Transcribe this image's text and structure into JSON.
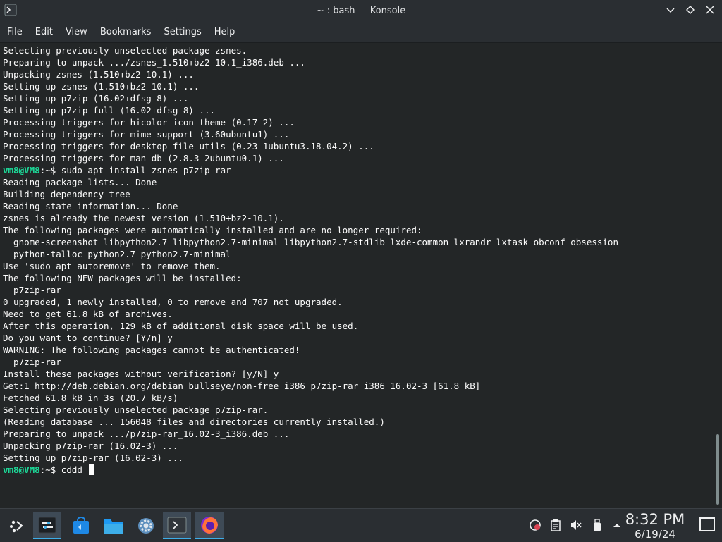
{
  "window": {
    "title": "~ : bash — Konsole"
  },
  "menu": [
    {
      "label": "File"
    },
    {
      "label": "Edit"
    },
    {
      "label": "View"
    },
    {
      "label": "Bookmarks"
    },
    {
      "label": "Settings"
    },
    {
      "label": "Help"
    }
  ],
  "terminal": {
    "lines": [
      {
        "text": "Selecting previously unselected package zsnes."
      },
      {
        "text": "Preparing to unpack .../zsnes_1.510+bz2-10.1_i386.deb ..."
      },
      {
        "text": "Unpacking zsnes (1.510+bz2-10.1) ..."
      },
      {
        "text": "Setting up zsnes (1.510+bz2-10.1) ..."
      },
      {
        "text": "Setting up p7zip (16.02+dfsg-8) ..."
      },
      {
        "text": "Setting up p7zip-full (16.02+dfsg-8) ..."
      },
      {
        "text": "Processing triggers for hicolor-icon-theme (0.17-2) ..."
      },
      {
        "text": "Processing triggers for mime-support (3.60ubuntu1) ..."
      },
      {
        "text": "Processing triggers for desktop-file-utils (0.23-1ubuntu3.18.04.2) ..."
      },
      {
        "text": "Processing triggers for man-db (2.8.3-2ubuntu0.1) ..."
      },
      {
        "prompt": "vm8@VM8",
        "path": ":~$ ",
        "text": "sudo apt install zsnes p7zip-rar"
      },
      {
        "text": "Reading package lists... Done"
      },
      {
        "text": "Building dependency tree"
      },
      {
        "text": "Reading state information... Done"
      },
      {
        "text": "zsnes is already the newest version (1.510+bz2-10.1)."
      },
      {
        "text": "The following packages were automatically installed and are no longer required:"
      },
      {
        "text": "  gnome-screenshot libpython2.7 libpython2.7-minimal libpython2.7-stdlib lxde-common lxrandr lxtask obconf obsession"
      },
      {
        "text": "  python-talloc python2.7 python2.7-minimal"
      },
      {
        "text": "Use 'sudo apt autoremove' to remove them."
      },
      {
        "text": "The following NEW packages will be installed:"
      },
      {
        "text": "  p7zip-rar"
      },
      {
        "text": "0 upgraded, 1 newly installed, 0 to remove and 707 not upgraded."
      },
      {
        "text": "Need to get 61.8 kB of archives."
      },
      {
        "text": "After this operation, 129 kB of additional disk space will be used."
      },
      {
        "text": "Do you want to continue? [Y/n] y"
      },
      {
        "text": "WARNING: The following packages cannot be authenticated!"
      },
      {
        "text": "  p7zip-rar"
      },
      {
        "text": "Install these packages without verification? [y/N] y"
      },
      {
        "text": "Get:1 http://deb.debian.org/debian bullseye/non-free i386 p7zip-rar i386 16.02-3 [61.8 kB]"
      },
      {
        "text": "Fetched 61.8 kB in 3s (20.7 kB/s)"
      },
      {
        "text": "Selecting previously unselected package p7zip-rar."
      },
      {
        "text": "(Reading database ... 156048 files and directories currently installed.)"
      },
      {
        "text": "Preparing to unpack .../p7zip-rar_16.02-3_i386.deb ..."
      },
      {
        "text": "Unpacking p7zip-rar (16.02-3) ..."
      },
      {
        "text": "Setting up p7zip-rar (16.02-3) ..."
      },
      {
        "prompt": "vm8@VM8",
        "path": ":~$ ",
        "text": "cddd ",
        "cursor": true
      }
    ]
  },
  "taskbar": {
    "clock_time": "8:32 PM",
    "clock_date": "6/19/24"
  },
  "colors": {
    "prompt": "#1cdc9a",
    "accent": "#3daee9"
  }
}
